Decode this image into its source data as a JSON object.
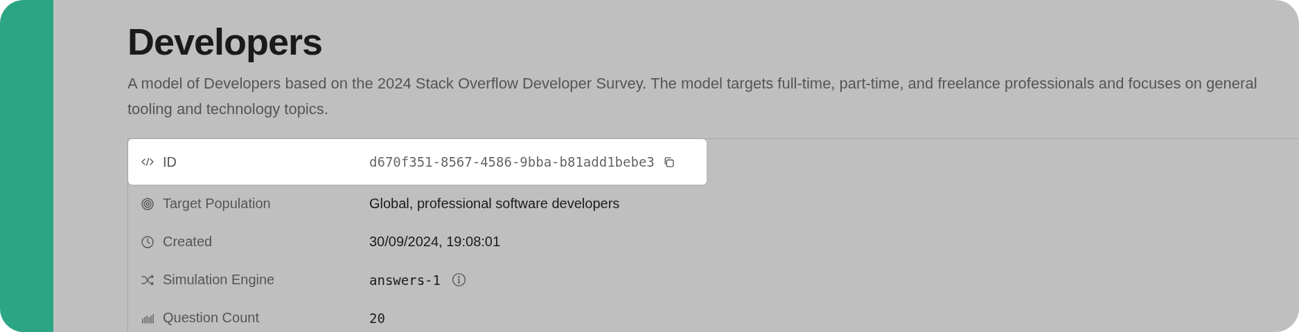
{
  "title": "Developers",
  "description": "A model of Developers based on the 2024 Stack Overflow Developer Survey. The model targets full-time, part-time, and freelance professionals and focuses on general tooling and technology topics.",
  "details": [
    {
      "kind": "id",
      "label": "ID",
      "value": "d670f351-8567-4586-9bba-b81add1bebe3",
      "mono": true,
      "highlighted": true
    },
    {
      "kind": "population",
      "label": "Target Population",
      "value": "Global, professional software developers",
      "mono": false,
      "highlighted": false
    },
    {
      "kind": "created",
      "label": "Created",
      "value": "30/09/2024, 19:08:01",
      "mono": false,
      "highlighted": false
    },
    {
      "kind": "engine",
      "label": "Simulation Engine",
      "value": "answers-1",
      "mono": true,
      "highlighted": false
    },
    {
      "kind": "count",
      "label": "Question Count",
      "value": "20",
      "mono": true,
      "highlighted": false
    }
  ]
}
